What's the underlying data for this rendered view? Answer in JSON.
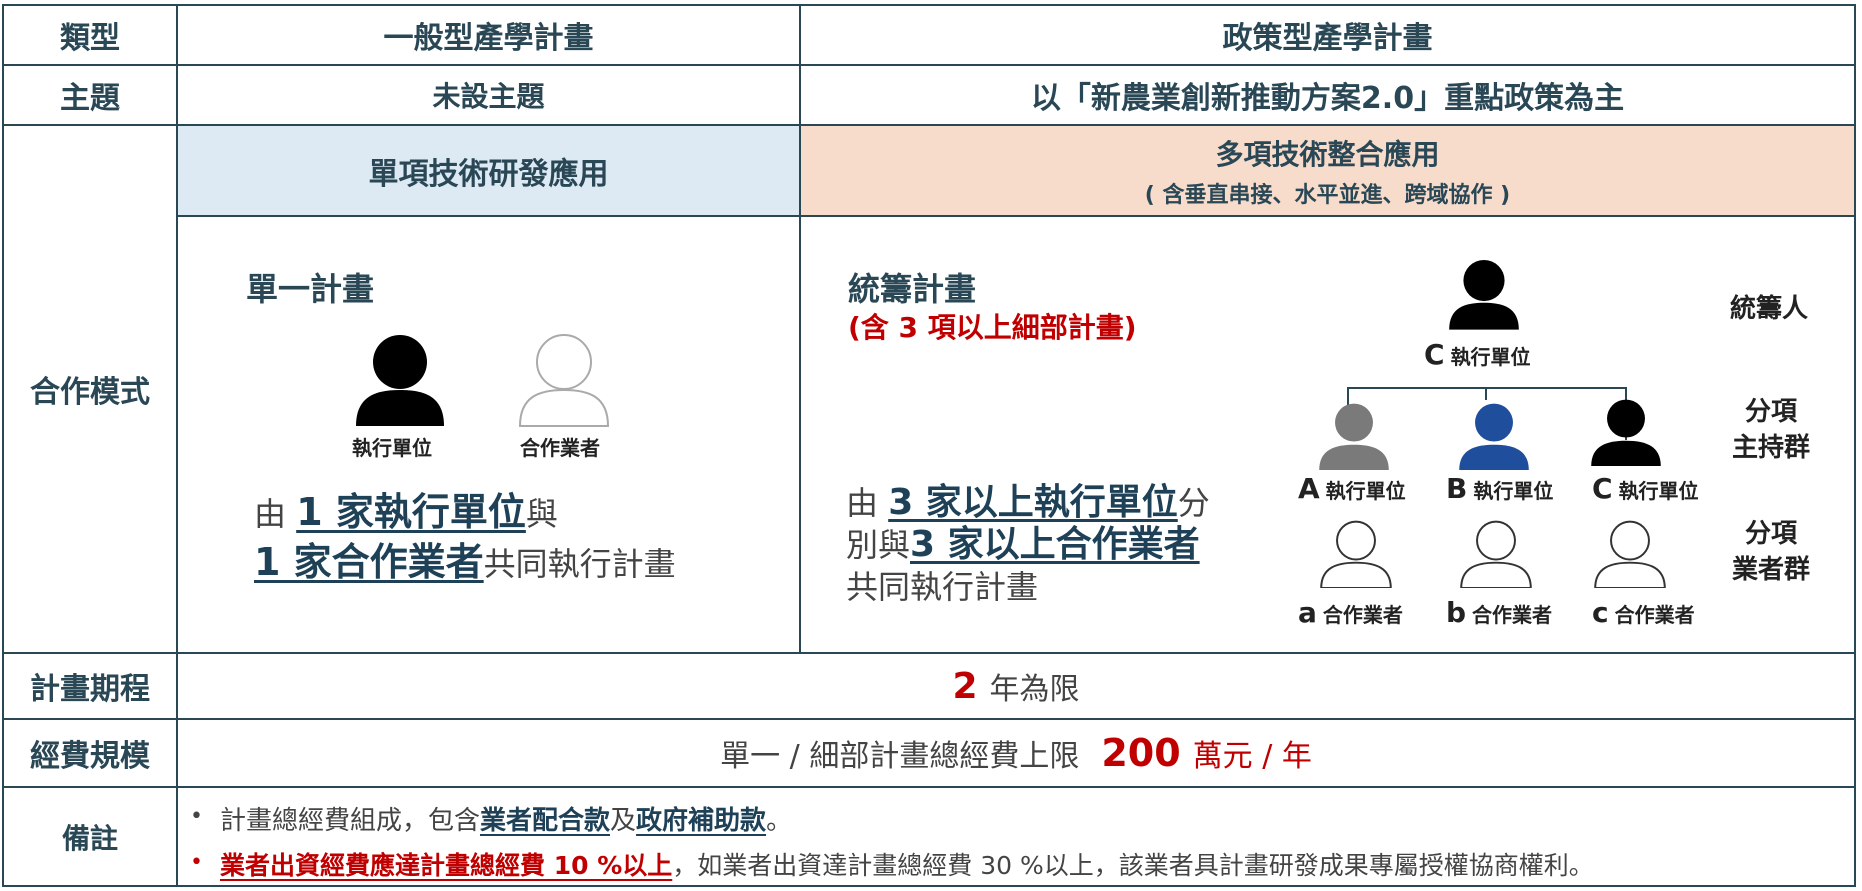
{
  "header": {
    "type_label": "類型",
    "general_title": "一般型產學計畫",
    "policy_title": "政策型產學計畫"
  },
  "theme_row": {
    "label": "主題",
    "general_value": "未設主題",
    "policy_prefix": "以「新農業創新推動方案2.0」重點政策為主"
  },
  "coop_row": {
    "label": "合作模式",
    "general_sub": "單項技術研發應用",
    "policy_sub": "多項技術整合應用",
    "policy_sub2": "( 含垂直串接、水平並進、跨域協作 )"
  },
  "general_mode": {
    "title": "單一計畫",
    "exec_label": "執行單位",
    "partner_label": "合作業者",
    "desc_1": "由",
    "desc_hl1": "1 家執行單位",
    "desc_2": "與",
    "desc_hl2": "1 家合作業者",
    "desc_3": "共同執行計畫"
  },
  "policy_mode": {
    "title": "統籌計畫",
    "subtitle": "(含 3 項以上細部計畫)",
    "desc_1": "由",
    "desc_hl1": "3 家以上執行單位",
    "desc_2": "分",
    "desc_3": "別與",
    "desc_hl2": "3 家以上合作業者",
    "desc_4": "共同執行計畫",
    "leader": {
      "letter": "C",
      "label": "執行單位"
    },
    "units": [
      {
        "letter": "A",
        "label": "執行單位",
        "color": "#7a7a7a"
      },
      {
        "letter": "B",
        "label": "執行單位",
        "color": "#1f4e9c"
      },
      {
        "letter": "C",
        "label": "執行單位",
        "color": "#000000"
      }
    ],
    "partners": [
      {
        "letter": "a",
        "label": "合作業者"
      },
      {
        "letter": "b",
        "label": "合作業者"
      },
      {
        "letter": "c",
        "label": "合作業者"
      }
    ],
    "role_leader": "統籌人",
    "role_group1_l1": "分項",
    "role_group1_l2": "主持群",
    "role_group2_l1": "分項",
    "role_group2_l2": "業者群"
  },
  "period_row": {
    "label": "計畫期程",
    "number": "2",
    "suffix": "年為限"
  },
  "budget_row": {
    "label": "經費規模",
    "prefix": "單一 / 細部計畫總經費上限",
    "number": "200",
    "suffix": "萬元 / 年"
  },
  "notes_row": {
    "label": "備註",
    "line1_a": "計畫總經費組成，包含",
    "line1_b": "業者配合款",
    "line1_c": "及",
    "line1_d": "政府補助款",
    "line1_e": "。",
    "line2_a": "業者出資經費應達計畫總經費 10 %以上",
    "line2_b": "，如業者出資達計畫總經費 30 %以上，該業者具計畫研發成果專屬授權協商權利。"
  },
  "colors": {
    "border": "#2a4756",
    "general_bg": "#dde9f3",
    "policy_bg": "#f8dccb",
    "accent_red": "#c00000"
  }
}
